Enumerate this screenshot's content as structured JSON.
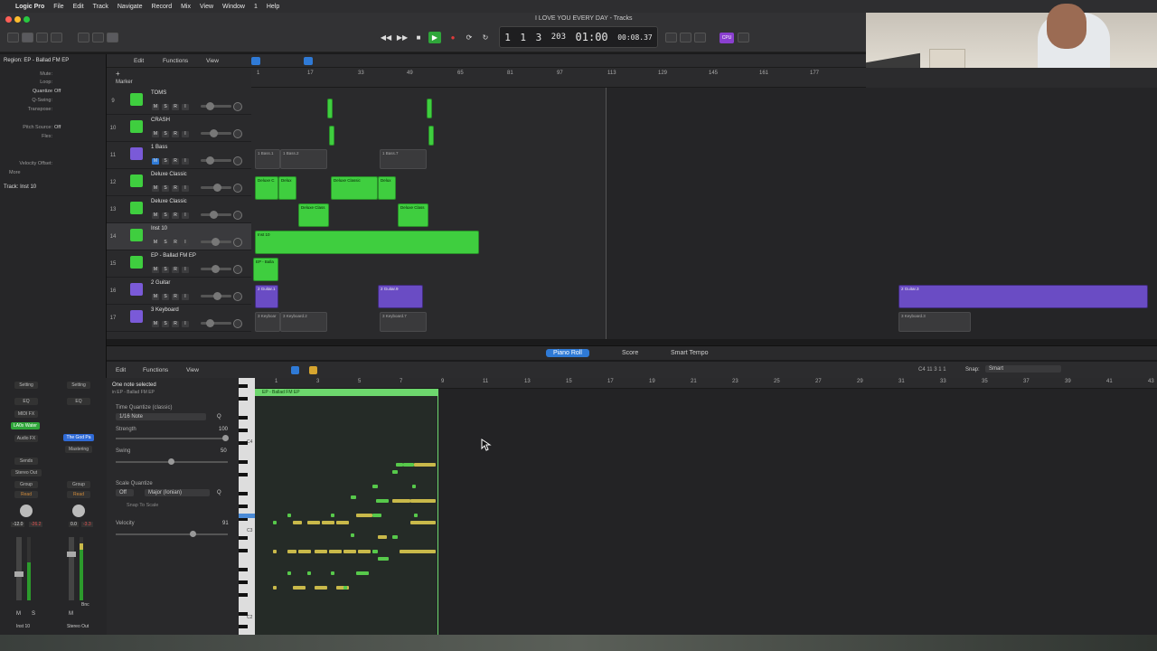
{
  "menubar": {
    "app": "Logic Pro",
    "items": [
      "File",
      "Edit",
      "Track",
      "Navigate",
      "Record",
      "Mix",
      "View",
      "Window",
      "1",
      "Help"
    ]
  },
  "window": {
    "title": "I LOVE YOU EVERY DAY - Tracks"
  },
  "lcd": {
    "bar": "1",
    "beat": "1",
    "div": "3",
    "tick": "203",
    "time": "01:00",
    "time_sub": "00:08.37"
  },
  "cpu_badge": "CPU",
  "inspector": {
    "region_title": "Region: EP - Ballad FM EP",
    "mute_label": "Mute:",
    "loop_label": "Loop:",
    "quantize_label": "Quantize",
    "quantize_value": "Off",
    "qswing_label": "Q-Swing:",
    "transpose_label": "Transpose:",
    "pitch_source_label": "Pitch Source:",
    "pitch_source_value": "Off",
    "flex_label": "Flex:",
    "velocity_offset_label": "Velocity Offset:",
    "more_label": "More",
    "track_title": "Track: Inst 10"
  },
  "tracks_toolbar": {
    "edit": "Edit",
    "functions": "Functions",
    "view": "View",
    "marker_label": "Marker"
  },
  "ruler": {
    "ticks": [
      "1",
      "17",
      "33",
      "49",
      "65",
      "81",
      "97",
      "113",
      "129",
      "145",
      "161",
      "177"
    ]
  },
  "tracks": [
    {
      "num": "9",
      "name": "TOMS",
      "color": "#3fce3f",
      "icon": "drum-icon"
    },
    {
      "num": "10",
      "name": "CRASH",
      "color": "#3fce3f",
      "icon": "drum-icon"
    },
    {
      "num": "11",
      "name": "1 Bass",
      "color": "#7a5ad8",
      "icon": "guitar-icon"
    },
    {
      "num": "12",
      "name": "Deluxe Classic",
      "color": "#3fce3f",
      "icon": "keys-icon"
    },
    {
      "num": "13",
      "name": "Deluxe Classic",
      "color": "#3fce3f",
      "icon": "keys-icon"
    },
    {
      "num": "14",
      "name": "Inst 10",
      "color": "#3fce3f",
      "icon": "keys-icon"
    },
    {
      "num": "15",
      "name": "EP - Ballad FM EP",
      "color": "#3fce3f",
      "icon": "keys-icon"
    },
    {
      "num": "16",
      "name": "2 Guitar",
      "color": "#7a5ad8",
      "icon": "guitar-icon"
    },
    {
      "num": "17",
      "name": "3 Keyboard",
      "color": "#7a5ad8",
      "icon": "keyboard-icon"
    }
  ],
  "track_buttons": {
    "m": "M",
    "s": "S",
    "r": "R",
    "i": "I"
  },
  "regions": {
    "bass1": "1 Bass.1",
    "bass2": "1 Bass.2",
    "bass7": "1 Bass.7",
    "deluxe1": "Deluxe C",
    "deluxe2": "Delux",
    "deluxe3": "Deluxe Classic",
    "deluxe4": "Delux",
    "deluxe5": "Deluxe Class",
    "deluxe6": "Deluxe Class",
    "inst10": "Inst 10",
    "epballad": "EP - Balla",
    "guitar1": "2 Guitar.1",
    "guitar9": "2 Guitar.9",
    "guitar3": "2 Guitar.3",
    "kbd1": "3 Keyboar",
    "kbd2": "3 Keyboard.2",
    "kbd7": "3 Keyboard.7",
    "kbd3": "3 Keyboard.3"
  },
  "editor": {
    "tabs": [
      "Piano Roll",
      "Score",
      "Smart Tempo"
    ],
    "edit": "Edit",
    "functions": "Functions",
    "view": "View",
    "position": "C4 11 3 1 1",
    "snap_label": "Snap:",
    "snap_value": "Smart",
    "status": "One note selected",
    "status_sub": "in EP - Ballad FM EP",
    "time_quantize_label": "Time Quantize (classic)",
    "time_quantize_value": "1/16 Note",
    "strength_label": "Strength",
    "strength_value": "100",
    "swing_label": "Swing",
    "swing_value": "50",
    "scale_quantize_label": "Scale Quantize",
    "scale_off": "Off",
    "scale_value": "Major (Ionian)",
    "snap_to_scale": "Snap To Scale",
    "velocity_label": "Velocity",
    "velocity_value": "91",
    "q_button": "Q",
    "region_label": "EP - Ballad FM EP",
    "ruler_ticks": [
      "1",
      "3",
      "5",
      "7",
      "9",
      "11",
      "13",
      "15",
      "17",
      "19",
      "21",
      "23",
      "25",
      "27",
      "29",
      "31",
      "33",
      "35",
      "37",
      "39",
      "41",
      "43"
    ],
    "piano_c4": "C4",
    "piano_c3": "C3",
    "piano_c2": "C2"
  },
  "mixer": {
    "setting": "Setting",
    "eq": "EQ",
    "midi_fx": "MIDI FX",
    "plugin1": "LA0x Water",
    "plugin2": "The God Pa",
    "audio_fx": "Audio FX",
    "mastering": "Mastering",
    "sends": "Sends",
    "stereo_out": "Stereo Out",
    "group": "Group",
    "read": "Read",
    "vol1": "-12.0",
    "peak1": "-26.2",
    "vol2": "0.0",
    "peak2": "-3.3",
    "bnc": "Bnc",
    "m": "M",
    "s": "S",
    "track_name": "Inst 10",
    "out_name": "Stereo Out"
  }
}
